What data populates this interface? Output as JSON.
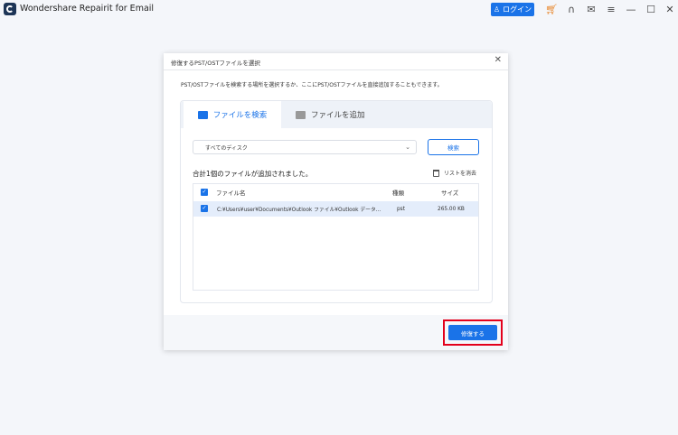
{
  "app": {
    "title": "Wondershare Repairit for Email",
    "login_label": "ログイン"
  },
  "colors": {
    "accent": "#1a73e8",
    "highlight": "#e3001b",
    "cart": "#e8862a"
  },
  "dialog": {
    "title": "修復するPST/OSTファイルを選択",
    "description": "PST/OSTファイルを検索する場所を選択するか、ここにPST/OSTファイルを直接追加することもできます。",
    "tabs": [
      {
        "label": "ファイルを検索",
        "icon": "search-file-icon",
        "active": true
      },
      {
        "label": "ファイルを追加",
        "icon": "add-file-icon",
        "active": false
      }
    ],
    "drive_select": {
      "value": "すべてのディスク"
    },
    "search_button": "検索",
    "count_text": "合計1個のファイルが追加されました。",
    "clear_list": "リストを消去",
    "table": {
      "headers": {
        "name": "ファイル名",
        "type": "種類",
        "size": "サイズ"
      },
      "rows": [
        {
          "checked": true,
          "name": "C:¥Users¥user¥Documents¥Outlook ファイル¥Outlook データ...",
          "type": "pst",
          "size": "265.00 KB"
        }
      ]
    },
    "repair_button": "修復する"
  }
}
